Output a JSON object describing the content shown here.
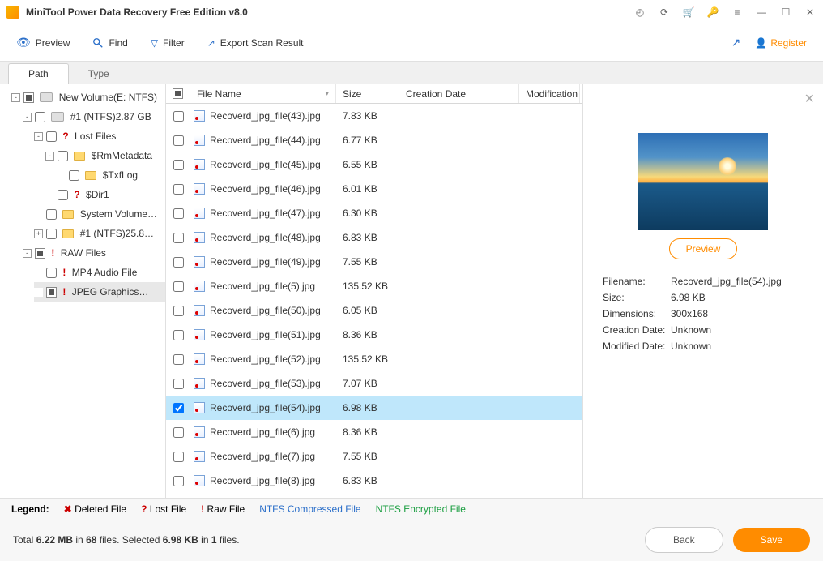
{
  "app": {
    "title": "MiniTool Power Data Recovery Free Edition v8.0"
  },
  "toolbar": {
    "preview": "Preview",
    "find": "Find",
    "filter": "Filter",
    "export": "Export Scan Result",
    "register": "Register"
  },
  "tabs": {
    "path": "Path",
    "type": "Type"
  },
  "tree": {
    "root": "New Volume(E: NTFS)",
    "n1": "#1 (NTFS)2.87 GB",
    "lost": "Lost Files",
    "rm": "$RmMetadata",
    "txf": "$TxfLog",
    "dir1": "$Dir1",
    "sys": "System Volume…",
    "n1b": "#1 (NTFS)25.8…",
    "raw": "RAW Files",
    "mp4": "MP4 Audio File",
    "jpeg": "JPEG Graphics…"
  },
  "columns": {
    "name": "File Name",
    "size": "Size",
    "cdate": "Creation Date",
    "mdate": "Modification"
  },
  "files": [
    {
      "name": "Recoverd_jpg_file(43).jpg",
      "size": "7.83 KB",
      "sel": false
    },
    {
      "name": "Recoverd_jpg_file(44).jpg",
      "size": "6.77 KB",
      "sel": false
    },
    {
      "name": "Recoverd_jpg_file(45).jpg",
      "size": "6.55 KB",
      "sel": false
    },
    {
      "name": "Recoverd_jpg_file(46).jpg",
      "size": "6.01 KB",
      "sel": false
    },
    {
      "name": "Recoverd_jpg_file(47).jpg",
      "size": "6.30 KB",
      "sel": false
    },
    {
      "name": "Recoverd_jpg_file(48).jpg",
      "size": "6.83 KB",
      "sel": false
    },
    {
      "name": "Recoverd_jpg_file(49).jpg",
      "size": "7.55 KB",
      "sel": false
    },
    {
      "name": "Recoverd_jpg_file(5).jpg",
      "size": "135.52 KB",
      "sel": false
    },
    {
      "name": "Recoverd_jpg_file(50).jpg",
      "size": "6.05 KB",
      "sel": false
    },
    {
      "name": "Recoverd_jpg_file(51).jpg",
      "size": "8.36 KB",
      "sel": false
    },
    {
      "name": "Recoverd_jpg_file(52).jpg",
      "size": "135.52 KB",
      "sel": false
    },
    {
      "name": "Recoverd_jpg_file(53).jpg",
      "size": "7.07 KB",
      "sel": false
    },
    {
      "name": "Recoverd_jpg_file(54).jpg",
      "size": "6.98 KB",
      "sel": true
    },
    {
      "name": "Recoverd_jpg_file(6).jpg",
      "size": "8.36 KB",
      "sel": false
    },
    {
      "name": "Recoverd_jpg_file(7).jpg",
      "size": "7.55 KB",
      "sel": false
    },
    {
      "name": "Recoverd_jpg_file(8).jpg",
      "size": "6.83 KB",
      "sel": false
    }
  ],
  "preview": {
    "button": "Preview",
    "filename_k": "Filename:",
    "filename_v": "Recoverd_jpg_file(54).jpg",
    "size_k": "Size:",
    "size_v": "6.98 KB",
    "dim_k": "Dimensions:",
    "dim_v": "300x168",
    "cdate_k": "Creation Date:",
    "cdate_v": "Unknown",
    "mdate_k": "Modified Date:",
    "mdate_v": "Unknown"
  },
  "legend": {
    "label": "Legend:",
    "deleted": "Deleted File",
    "lost": "Lost File",
    "raw": "Raw File",
    "comp": "NTFS Compressed File",
    "enc": "NTFS Encrypted File"
  },
  "status": {
    "p1": "Total ",
    "total_size": "6.22 MB",
    "p2": " in ",
    "total_count": "68",
    "p3": " files.   Selected ",
    "sel_size": "6.98 KB",
    "p4": " in ",
    "sel_count": "1",
    "p5": " files."
  },
  "buttons": {
    "back": "Back",
    "save": "Save"
  }
}
